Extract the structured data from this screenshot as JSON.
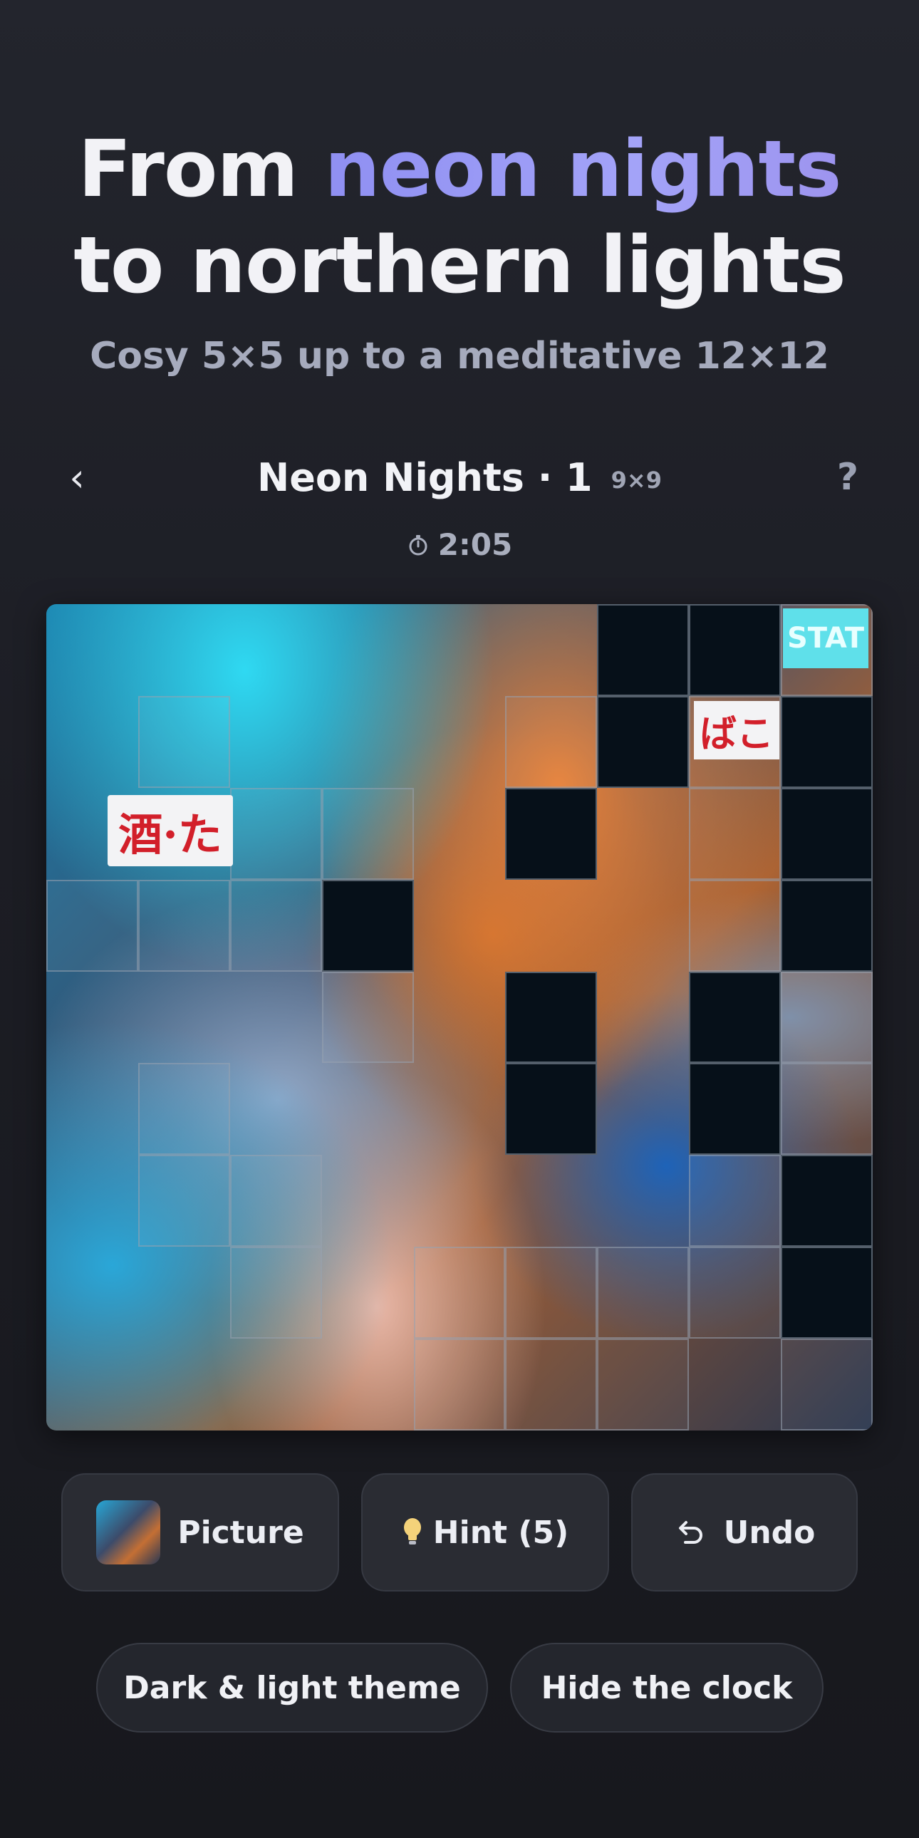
{
  "headline": {
    "line1_plain": "From ",
    "line1_accent": "neon nights",
    "line2": "to northern lights",
    "accent_color": "#9c9cf6"
  },
  "subtitle": "Cosy 5×5 up to a meditative 12×12",
  "game": {
    "back_icon": "‹",
    "title": "Neon Nights · 1",
    "size": "9×9",
    "help_icon": "?",
    "timer": "2:05"
  },
  "board": {
    "rows": 9,
    "cols": 9,
    "empty_color": "#061019",
    "tile_border_color": "#969faf",
    "empty_tiles": [
      [
        0,
        6
      ],
      [
        0,
        7
      ],
      [
        1,
        6
      ],
      [
        1,
        8
      ],
      [
        2,
        5
      ],
      [
        2,
        8
      ],
      [
        3,
        3
      ],
      [
        3,
        8
      ],
      [
        4,
        5
      ],
      [
        4,
        7
      ],
      [
        5,
        5
      ],
      [
        5,
        7
      ],
      [
        6,
        8
      ],
      [
        7,
        8
      ]
    ],
    "framed_tiles": [
      [
        0,
        8
      ],
      [
        1,
        1
      ],
      [
        1,
        5
      ],
      [
        1,
        7
      ],
      [
        2,
        2
      ],
      [
        2,
        3
      ],
      [
        2,
        7
      ],
      [
        3,
        0
      ],
      [
        3,
        1
      ],
      [
        3,
        2
      ],
      [
        3,
        7
      ],
      [
        4,
        3
      ],
      [
        4,
        8
      ],
      [
        5,
        1
      ],
      [
        5,
        8
      ],
      [
        6,
        1
      ],
      [
        6,
        2
      ],
      [
        6,
        7
      ],
      [
        7,
        2
      ],
      [
        7,
        4
      ],
      [
        7,
        5
      ],
      [
        7,
        6
      ],
      [
        7,
        7
      ],
      [
        8,
        4
      ],
      [
        8,
        5
      ],
      [
        8,
        6
      ],
      [
        8,
        8
      ]
    ],
    "signs": {
      "sake": "酒·た",
      "station": "STAT",
      "hako": "ばこ"
    }
  },
  "controls": {
    "picture_label": "Picture",
    "hint_label": "Hint (5)",
    "undo_label": "Undo"
  },
  "chips": {
    "theme_label": "Dark & light theme",
    "clock_label": "Hide the clock"
  }
}
